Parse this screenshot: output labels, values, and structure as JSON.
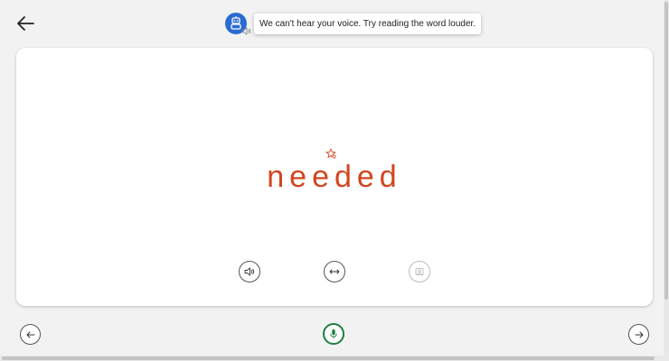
{
  "header": {
    "back_icon": "arrow-left-icon",
    "coach_icon": "robot-icon",
    "speaker_icon": "speaker-icon",
    "tooltip_text": "We can't hear your voice. Try reading the word louder."
  },
  "card": {
    "sparkle_icon": "sparkle-star-icon",
    "word": "needed",
    "word_color": "#d2451e",
    "actions": [
      {
        "name": "listen",
        "icon": "speaker-icon",
        "enabled": true
      },
      {
        "name": "syllables",
        "icon": "split-arrows-icon",
        "enabled": true
      },
      {
        "name": "picture",
        "icon": "picture-dictionary-icon",
        "enabled": false
      }
    ]
  },
  "footer": {
    "prev_icon": "arrow-left-icon",
    "mic_icon": "microphone-icon",
    "mic_color": "#1e7e3e",
    "next_icon": "arrow-right-icon"
  },
  "colors": {
    "background": "#f2f2f2",
    "accent_blue": "#2a6bd1"
  }
}
